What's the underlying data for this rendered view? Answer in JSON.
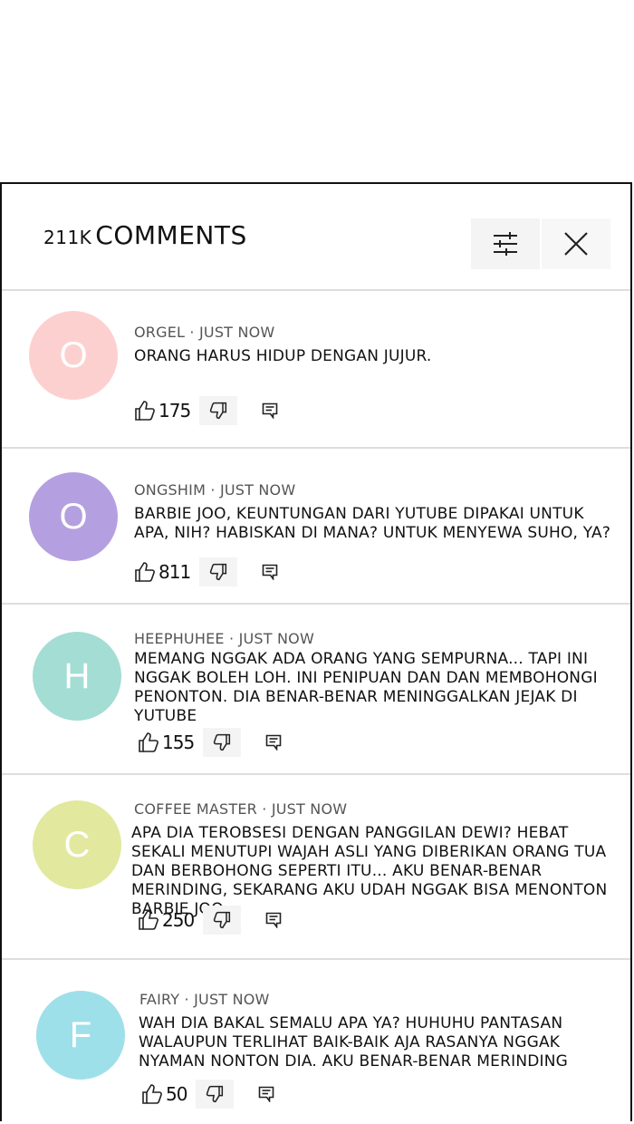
{
  "header": {
    "count": "211K",
    "title": "COMMENTS"
  },
  "comments": [
    {
      "initial": "O",
      "color": "#fdd0d0",
      "author": "ORGEL",
      "time": "JUST NOW",
      "text": "ORANG HARUS HIDUP DENGAN JUJUR.",
      "likes": "175"
    },
    {
      "initial": "O",
      "color": "#b4a0e0",
      "author": "ONGSHIM",
      "time": "JUST NOW",
      "text": "BARBIE JOO, KEUNTUNGAN DARI YUTUBE DIPAKAI UNTUK APA, NIH? HABISKAN DI MANA? UNTUK MENYEWA SUHO, YA?",
      "likes": "811"
    },
    {
      "initial": "H",
      "color": "#a3ddd4",
      "author": "HEEPHUHEE",
      "time": "JUST NOW",
      "text": "MEMANG NGGAK ADA ORANG YANG SEMPURNA... TAPI INI NGGAK BOLEH LOH. INI PENIPUAN DAN DAN MEMBOHONGI PENONTON. DIA BENAR-BENAR MENINGGALKAN JEJAK DI YUTUBE",
      "likes": "155"
    },
    {
      "initial": "C",
      "color": "#e2e89e",
      "author": "COFFEE MASTER",
      "time": "JUST NOW",
      "text": "APA DIA TEROBSESI DENGAN PANGGILAN DEWI? HEBAT SEKALI MENUTUPI WAJAH ASLI YANG DIBERIKAN ORANG TUA DAN BERBOHONG SEPERTI ITU... AKU BENAR-BENAR MERINDING, SEKARANG AKU UDAH NGGAK BISA MENONTON BARBIE JOO",
      "likes": "250"
    },
    {
      "initial": "F",
      "color": "#9ee0ea",
      "author": "FAIRY",
      "time": "JUST NOW",
      "text": "WAH DIA BAKAL SEMALU APA YA? HUHUHU PANTASAN WALAUPUN TERLIHAT BAIK-BAIK AJA RASANYA NGGAK NYAMAN NONTON DIA. AKU BENAR-BENAR MERINDING",
      "likes": "50"
    }
  ]
}
